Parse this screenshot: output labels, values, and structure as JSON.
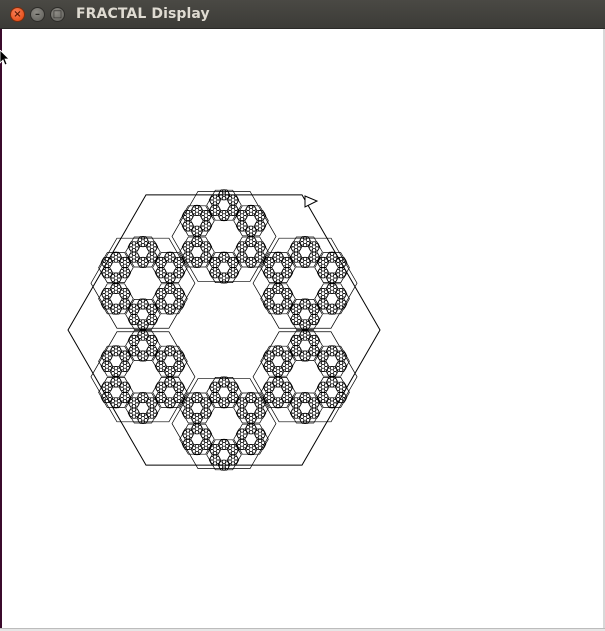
{
  "window": {
    "title": "FRACTAL Display",
    "buttons": {
      "close_glyph": "×",
      "minimize_glyph": "–",
      "maximize_glyph": "□"
    }
  },
  "fractal": {
    "stroke_color": "#000000",
    "background_color": "#ffffff",
    "recursion_depth": 4
  }
}
